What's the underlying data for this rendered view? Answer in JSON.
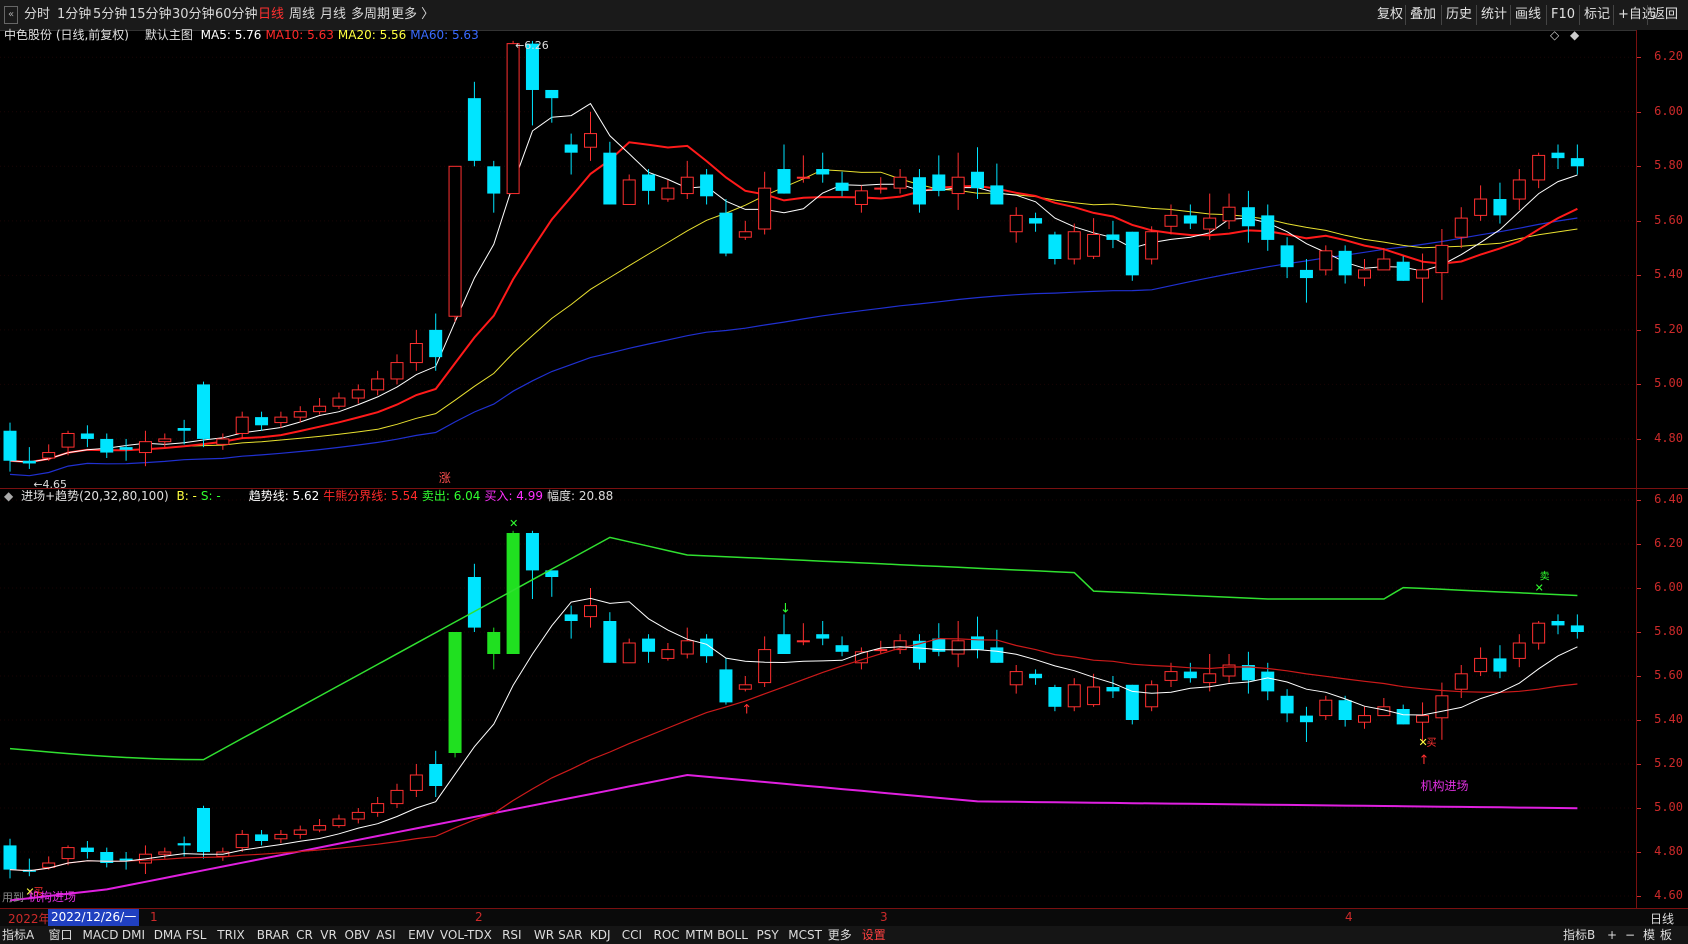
{
  "toolbar": {
    "periods": [
      "分时",
      "1分钟",
      "5分钟",
      "15分钟",
      "30分钟",
      "60分钟",
      "日线",
      "周线",
      "月线",
      "多周期",
      "更多 〉"
    ],
    "active_period": "日线",
    "right_buttons": [
      "复权",
      "叠加",
      "历史",
      "统计",
      "画线",
      "F10",
      "标记",
      "+自选",
      "返回"
    ]
  },
  "main_chart": {
    "title": "中色股份 (日线,前复权)",
    "template": "默认主图",
    "ma_labels": [
      {
        "text": "MA5: 5.76",
        "color": "#ffffff"
      },
      {
        "text": "MA10: 5.63",
        "color": "#ff2a2a"
      },
      {
        "text": "MA20: 5.56",
        "color": "#ffff40"
      },
      {
        "text": "MA60: 5.63",
        "color": "#3a6bff"
      }
    ],
    "y_ticks": [
      "6.20",
      "6.00",
      "5.80",
      "5.60",
      "5.40",
      "5.20",
      "5.00",
      "4.80"
    ],
    "high_marker": "6.26",
    "low_marker": "←4.65",
    "rise_marker": "涨"
  },
  "indicator_chart": {
    "name": "进场+趋势(20,32,80,100)",
    "labels": [
      {
        "text": "B: -",
        "color": "#ffff40"
      },
      {
        "text": "S: -",
        "color": "#30ff30"
      },
      {
        "text": "趋势线: 5.62",
        "color": "#ffffff"
      },
      {
        "text": "牛熊分界线: 5.54",
        "color": "#ff2a2a"
      },
      {
        "text": "卖出: 6.04",
        "color": "#30ff30"
      },
      {
        "text": "买入: 4.99",
        "color": "#ff30ff"
      },
      {
        "text": "幅度: 20.88",
        "color": "#dddddd"
      }
    ],
    "y_ticks": [
      "6.40",
      "6.20",
      "6.00",
      "5.80",
      "5.60",
      "5.40",
      "5.20",
      "5.00",
      "4.80",
      "4.60"
    ],
    "annotation_entry": "机构进场",
    "annotation_entry_left": "机构进场",
    "sell_char": "卖",
    "buy_char": "买",
    "left_small": "用到"
  },
  "date_axis": {
    "current_date": "2022/12/26/一",
    "year_label": "2022年",
    "months": [
      "1",
      "2",
      "3",
      "4"
    ],
    "right_label": "日线"
  },
  "bottom_tabs": [
    "指标A",
    "窗口",
    "MACD",
    "DMI",
    "DMA",
    "FSL",
    "TRIX",
    "BRAR",
    "CR",
    "VR",
    "OBV",
    "ASI",
    "EMV",
    "VOL-TDX",
    "RSI",
    "WR",
    "SAR",
    "KDJ",
    "CCI",
    "ROC",
    "MTM",
    "BOLL",
    "PSY",
    "MCST",
    "更多",
    "设置"
  ],
  "bottom_right": [
    "指标B",
    "+",
    "−",
    "模",
    "板"
  ],
  "colors": {
    "up": "#ff3030",
    "down": "#00e5ff",
    "ma5": "#ffffff",
    "ma10": "#ff1a1a",
    "ma20": "#e8e030",
    "ma60": "#2030d0",
    "upper": "#30e030",
    "lower": "#e020e0"
  },
  "chart_data": {
    "type": "candlestick",
    "title": "中色股份 (日线,前复权)",
    "ylim_main": [
      4.62,
      6.3
    ],
    "ylim_indicator": [
      4.55,
      6.45
    ],
    "candles": [
      [
        4.83,
        4.72,
        4.86,
        4.68
      ],
      [
        4.72,
        4.71,
        4.77,
        4.69
      ],
      [
        4.73,
        4.75,
        4.78,
        4.72
      ],
      [
        4.77,
        4.82,
        4.83,
        4.74
      ],
      [
        4.82,
        4.8,
        4.85,
        4.77
      ],
      [
        4.8,
        4.75,
        4.82,
        4.73
      ],
      [
        4.77,
        4.76,
        4.8,
        4.72
      ],
      [
        4.75,
        4.79,
        4.83,
        4.7
      ],
      [
        4.79,
        4.8,
        4.82,
        4.77
      ],
      [
        4.84,
        4.83,
        4.87,
        4.78
      ],
      [
        5.0,
        4.8,
        5.01,
        4.77
      ],
      [
        4.78,
        4.8,
        4.82,
        4.76
      ],
      [
        4.82,
        4.88,
        4.9,
        4.8
      ],
      [
        4.88,
        4.85,
        4.9,
        4.83
      ],
      [
        4.86,
        4.88,
        4.9,
        4.84
      ],
      [
        4.88,
        4.9,
        4.92,
        4.86
      ],
      [
        4.9,
        4.92,
        4.95,
        4.89
      ],
      [
        4.92,
        4.95,
        4.97,
        4.91
      ],
      [
        4.95,
        4.98,
        5.0,
        4.93
      ],
      [
        4.98,
        5.02,
        5.05,
        4.96
      ],
      [
        5.02,
        5.08,
        5.11,
        5.0
      ],
      [
        5.08,
        5.15,
        5.2,
        5.05
      ],
      [
        5.2,
        5.1,
        5.26,
        5.05
      ],
      [
        5.25,
        5.8,
        5.8,
        5.23
      ],
      [
        6.05,
        5.82,
        6.11,
        5.8
      ],
      [
        5.8,
        5.7,
        5.82,
        5.63
      ],
      [
        5.7,
        6.25,
        6.26,
        5.7
      ],
      [
        6.25,
        6.08,
        6.26,
        5.95
      ],
      [
        6.08,
        6.05,
        6.08,
        5.96
      ],
      [
        5.88,
        5.85,
        5.92,
        5.77
      ],
      [
        5.87,
        5.92,
        6.0,
        5.82
      ],
      [
        5.85,
        5.66,
        5.89,
        5.66
      ],
      [
        5.66,
        5.75,
        5.77,
        5.69
      ],
      [
        5.77,
        5.71,
        5.79,
        5.66
      ],
      [
        5.68,
        5.72,
        5.75,
        5.67
      ],
      [
        5.7,
        5.76,
        5.82,
        5.68
      ],
      [
        5.77,
        5.69,
        5.79,
        5.66
      ],
      [
        5.63,
        5.48,
        5.68,
        5.47
      ],
      [
        5.54,
        5.56,
        5.6,
        5.53
      ],
      [
        5.57,
        5.72,
        5.78,
        5.55
      ],
      [
        5.79,
        5.7,
        5.88,
        5.7
      ],
      [
        5.76,
        5.76,
        5.84,
        5.74
      ],
      [
        5.79,
        5.77,
        5.85,
        5.74
      ],
      [
        5.74,
        5.71,
        5.78,
        5.69
      ],
      [
        5.66,
        5.71,
        5.73,
        5.63
      ],
      [
        5.72,
        5.72,
        5.76,
        5.7
      ],
      [
        5.72,
        5.76,
        5.79,
        5.7
      ],
      [
        5.76,
        5.66,
        5.79,
        5.63
      ],
      [
        5.77,
        5.71,
        5.84,
        5.69
      ],
      [
        5.7,
        5.76,
        5.85,
        5.64
      ],
      [
        5.78,
        5.72,
        5.87,
        5.68
      ],
      [
        5.73,
        5.66,
        5.81,
        5.66
      ],
      [
        5.56,
        5.62,
        5.65,
        5.52
      ],
      [
        5.61,
        5.59,
        5.63,
        5.56
      ],
      [
        5.55,
        5.46,
        5.56,
        5.44
      ],
      [
        5.46,
        5.56,
        5.59,
        5.44
      ],
      [
        5.47,
        5.55,
        5.61,
        5.46
      ],
      [
        5.55,
        5.53,
        5.6,
        5.5
      ],
      [
        5.56,
        5.4,
        5.56,
        5.38
      ],
      [
        5.46,
        5.56,
        5.58,
        5.44
      ],
      [
        5.58,
        5.62,
        5.66,
        5.55
      ],
      [
        5.62,
        5.59,
        5.66,
        5.57
      ],
      [
        5.57,
        5.61,
        5.7,
        5.53
      ],
      [
        5.6,
        5.65,
        5.7,
        5.57
      ],
      [
        5.65,
        5.58,
        5.71,
        5.52
      ],
      [
        5.62,
        5.53,
        5.66,
        5.49
      ],
      [
        5.51,
        5.43,
        5.54,
        5.39
      ],
      [
        5.42,
        5.39,
        5.46,
        5.3
      ],
      [
        5.42,
        5.49,
        5.51,
        5.4
      ],
      [
        5.49,
        5.4,
        5.51,
        5.37
      ],
      [
        5.39,
        5.42,
        5.46,
        5.36
      ],
      [
        5.42,
        5.46,
        5.5,
        5.42
      ],
      [
        5.45,
        5.38,
        5.47,
        5.38
      ],
      [
        5.39,
        5.42,
        5.48,
        5.3
      ],
      [
        5.41,
        5.51,
        5.57,
        5.31
      ],
      [
        5.54,
        5.61,
        5.65,
        5.5
      ],
      [
        5.62,
        5.68,
        5.73,
        5.6
      ],
      [
        5.68,
        5.62,
        5.74,
        5.59
      ],
      [
        5.68,
        5.75,
        5.79,
        5.64
      ],
      [
        5.75,
        5.84,
        5.85,
        5.72
      ],
      [
        5.85,
        5.83,
        5.88,
        5.79
      ],
      [
        5.83,
        5.8,
        5.88,
        5.77
      ]
    ]
  }
}
